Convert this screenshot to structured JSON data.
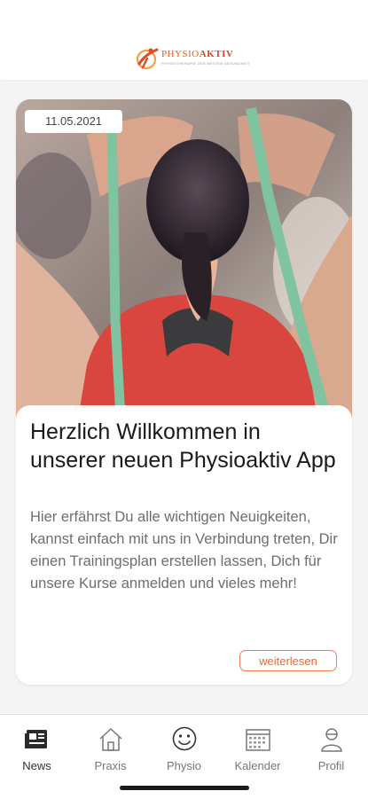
{
  "header": {
    "logo_text_a": "PHYSIO",
    "logo_text_b": "AKTIV",
    "logo_tagline": "PHYSIOTHERAPIE DER BESTEN GESUNDHEIT"
  },
  "feed": {
    "posts": [
      {
        "date": "11.05.2021",
        "title": "Herzlich Willkommen in unserer neuen Physioaktiv App",
        "text": "Hier erfährst Du alle wichtigen Neuigkeiten, kannst einfach mit uns in Verbindung treten, Dir einen Trainingsplan erstellen lassen, Dich für unsere Kurse anmelden und vieles mehr!",
        "more_label": "weiterlesen"
      }
    ]
  },
  "tabbar": {
    "tabs": [
      {
        "label": "News",
        "icon": "news-icon",
        "active": true
      },
      {
        "label": "Praxis",
        "icon": "house-icon",
        "active": false
      },
      {
        "label": "Physio",
        "icon": "smiley-icon",
        "active": false
      },
      {
        "label": "Kalender",
        "icon": "calendar-icon",
        "active": false
      },
      {
        "label": "Profil",
        "icon": "person-icon",
        "active": false
      }
    ]
  },
  "colors": {
    "accent": "#ec6a2c",
    "text": "#1a1a1a",
    "muted": "#6e6e6e",
    "feed_bg": "#f4f4f4"
  }
}
